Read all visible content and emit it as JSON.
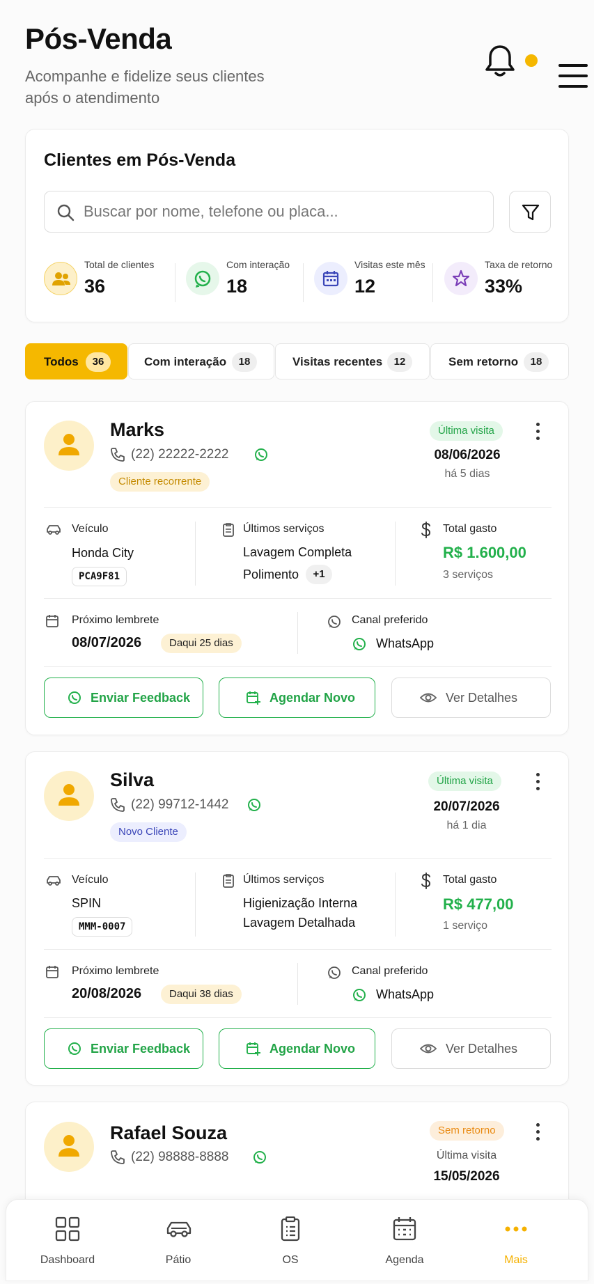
{
  "header": {
    "title": "Pós-Venda",
    "subtitle": "Acompanhe e fidelize seus clientes após o atendimento"
  },
  "summary": {
    "title": "Clientes em Pós-Venda",
    "search_placeholder": "Buscar por nome, telefone ou placa...",
    "stats": [
      {
        "label": "Total de clientes",
        "value": "36",
        "icon": "users-icon",
        "color": "#f5b800"
      },
      {
        "label": "Com interação",
        "value": "18",
        "icon": "whatsapp-icon",
        "color": "#22b04b"
      },
      {
        "label": "Visitas este mês",
        "value": "12",
        "icon": "calendar-icon",
        "color": "#3b46b8"
      },
      {
        "label": "Taxa de retorno",
        "value": "33%",
        "icon": "star-icon",
        "color": "#7b3fb8"
      }
    ]
  },
  "tabs": [
    {
      "label": "Todos",
      "count": "36",
      "active": true
    },
    {
      "label": "Com interação",
      "count": "18"
    },
    {
      "label": "Visitas recentes",
      "count": "12"
    },
    {
      "label": "Sem retorno",
      "count": "18"
    }
  ],
  "labels": {
    "vehicle": "Veículo",
    "services": "Últimos serviços",
    "total": "Total gasto",
    "reminder": "Próximo lembrete",
    "channel": "Canal preferido",
    "last_visit": "Última visita",
    "send_feedback": "Enviar Feedback",
    "schedule_new": "Agendar Novo",
    "view_details": "Ver Detalhes"
  },
  "clients": [
    {
      "name": "Marks",
      "phone": "(22) 22222-2222",
      "tag": "Cliente recorrente",
      "status": "Última visita",
      "last_visit_date": "08/06/2026",
      "last_visit_ago": "há 5 dias",
      "vehicle": "Honda City",
      "plate": "PCA9F81",
      "services": [
        "Lavagem Completa",
        "Polimento"
      ],
      "services_more": "+1",
      "total": "R$ 1.600,00",
      "total_count": "3 serviços",
      "reminder_date": "08/07/2026",
      "reminder_in": "Daqui 25 dias",
      "channel": "WhatsApp"
    },
    {
      "name": "Silva",
      "phone": "(22) 99712-1442",
      "tag": "Novo Cliente",
      "status": "Última visita",
      "last_visit_date": "20/07/2026",
      "last_visit_ago": "há 1 dia",
      "vehicle": "SPIN",
      "plate": "MMM-0007",
      "services": [
        "Higienização Interna",
        "Lavagem Detalhada"
      ],
      "total": "R$ 477,00",
      "total_count": "1 serviço",
      "reminder_date": "20/08/2026",
      "reminder_in": "Daqui 38 dias",
      "channel": "WhatsApp"
    },
    {
      "name": "Rafael Souza",
      "phone": "(22) 98888-8888",
      "status": "Sem retorno",
      "last_visit_label": "Última visita",
      "last_visit_date": "15/05/2026"
    }
  ],
  "nav": [
    {
      "label": "Dashboard",
      "icon": "grid-icon"
    },
    {
      "label": "Pátio",
      "icon": "car-icon"
    },
    {
      "label": "OS",
      "icon": "clipboard-icon"
    },
    {
      "label": "Agenda",
      "icon": "calendar-icon"
    },
    {
      "label": "Mais",
      "icon": "more-dots-icon",
      "active": true
    }
  ],
  "colors": {
    "accent": "#f5b800",
    "green": "#22b04b",
    "orange": "#e98b14"
  }
}
